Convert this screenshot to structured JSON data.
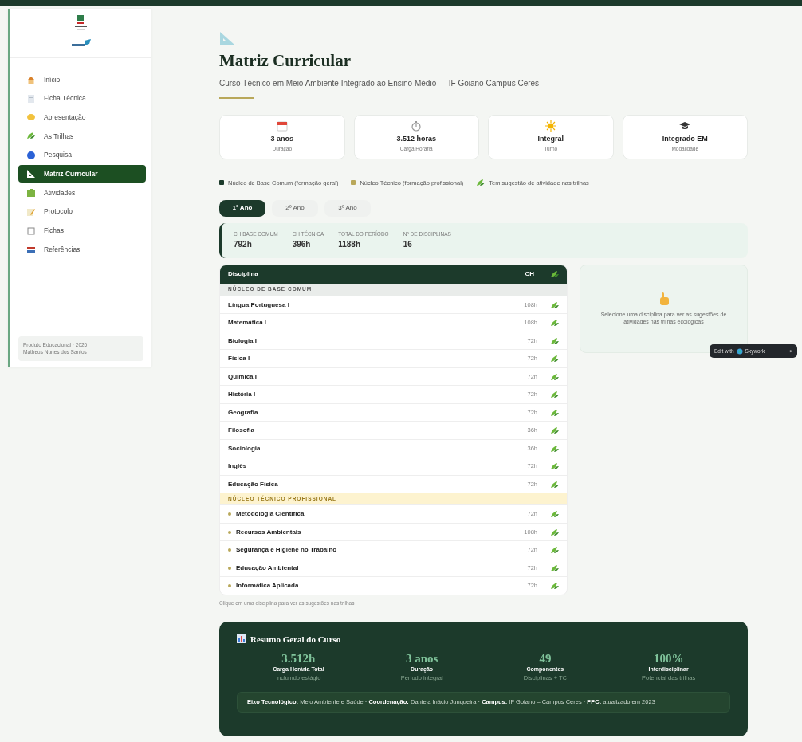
{
  "sidebar": {
    "items": [
      {
        "label": "Início",
        "selected": false
      },
      {
        "label": "Ficha Técnica",
        "selected": false
      },
      {
        "label": "Apresentação",
        "selected": false
      },
      {
        "label": "As Trilhas",
        "selected": false
      },
      {
        "label": "Pesquisa",
        "selected": false
      },
      {
        "label": "Matriz Curricular",
        "selected": true
      },
      {
        "label": "Atividades",
        "selected": false
      },
      {
        "label": "Protocolo",
        "selected": false
      },
      {
        "label": "Fichas",
        "selected": false
      },
      {
        "label": "Referências",
        "selected": false
      }
    ],
    "footer": [
      "Produto Educacional · 2026",
      "Matheus Nunes dos Santos"
    ]
  },
  "header": {
    "title": "Matriz Curricular",
    "subtitle": "Curso Técnico em Meio Ambiente Integrado ao Ensino Médio — IF Goiano Campus Ceres"
  },
  "facts": [
    {
      "value": "3 anos",
      "label": "Duração"
    },
    {
      "value": "3.512 horas",
      "label": "Carga Horária"
    },
    {
      "value": "Integral",
      "label": "Turno"
    },
    {
      "value": "Integrado EM",
      "label": "Modalidade"
    }
  ],
  "legend": [
    {
      "kind": "dot",
      "label": "Núcleo de Base Comum (formação geral)",
      "color": "#1b3a2a"
    },
    {
      "kind": "dot",
      "label": "Núcleo Técnico (formação profissional)",
      "color": "#b9a85a"
    },
    {
      "kind": "leaf",
      "label": "Tem sugestão de atividade nas trilhas"
    }
  ],
  "tabs": [
    {
      "label": "1º Ano",
      "selected": true
    },
    {
      "label": "2º Ano",
      "selected": false
    },
    {
      "label": "3º Ano",
      "selected": false
    }
  ],
  "summary": [
    {
      "label": "CH BASE COMUM",
      "value": "792h"
    },
    {
      "label": "CH TÉCNICA",
      "value": "396h"
    },
    {
      "label": "TOTAL DO PERÍODO",
      "value": "1188h"
    },
    {
      "label": "Nº DE DISCIPLINAS",
      "value": "16"
    }
  ],
  "table": {
    "columns": [
      "Disciplina",
      "CH"
    ],
    "sections": [
      {
        "kind": "base",
        "title": "NÚCLEO DE BASE COMUM",
        "rows": [
          {
            "name": "Língua Portuguesa I",
            "ch": "108h",
            "trail": true
          },
          {
            "name": "Matemática I",
            "ch": "108h",
            "trail": true
          },
          {
            "name": "Biologia I",
            "ch": "72h",
            "trail": true
          },
          {
            "name": "Física I",
            "ch": "72h",
            "trail": true
          },
          {
            "name": "Química I",
            "ch": "72h",
            "trail": true
          },
          {
            "name": "História I",
            "ch": "72h",
            "trail": true
          },
          {
            "name": "Geografia",
            "ch": "72h",
            "trail": true
          },
          {
            "name": "Filosofia",
            "ch": "36h",
            "trail": true
          },
          {
            "name": "Sociologia",
            "ch": "36h",
            "trail": true
          },
          {
            "name": "Inglês",
            "ch": "72h",
            "trail": true
          },
          {
            "name": "Educação Física",
            "ch": "72h",
            "trail": true
          }
        ]
      },
      {
        "kind": "tecnico",
        "title": "NÚCLEO TÉCNICO PROFISSIONAL",
        "rows": [
          {
            "name": "Metodologia Científica",
            "ch": "72h",
            "trail": true
          },
          {
            "name": "Recursos Ambientais",
            "ch": "108h",
            "trail": true
          },
          {
            "name": "Segurança e Higiene no Trabalho",
            "ch": "72h",
            "trail": true
          },
          {
            "name": "Educação Ambiental",
            "ch": "72h",
            "trail": true
          },
          {
            "name": "Informática Aplicada",
            "ch": "72h",
            "trail": true
          }
        ]
      }
    ],
    "caption": "Clique em uma disciplina para ver as sugestões nas trilhas"
  },
  "hint_panel": {
    "text": "Selecione uma disciplina para ver as sugestões de atividades nas trilhas ecológicas"
  },
  "overview": {
    "title": "Resumo Geral do Curso",
    "stats": [
      {
        "value": "3.512h",
        "label": "Carga Horária Total",
        "sub": "incluindo estágio"
      },
      {
        "value": "3 anos",
        "label": "Duração",
        "sub": "Período integral"
      },
      {
        "value": "49",
        "label": "Componentes",
        "sub": "Disciplinas + TC"
      },
      {
        "value": "100%",
        "label": "Interdisciplinar",
        "sub": "Potencial das trilhas"
      }
    ],
    "note": "**Eixo Tecnológico:** Meio Ambiente e Saúde · **Coordenação:** Daniela Inácio Junqueira · **Campus:** IF Goiano – Campus Ceres · **PPC:** atualizado em 2023"
  },
  "edit_badge": {
    "label": "Edit with",
    "brand": "Skywork",
    "close": "×"
  }
}
